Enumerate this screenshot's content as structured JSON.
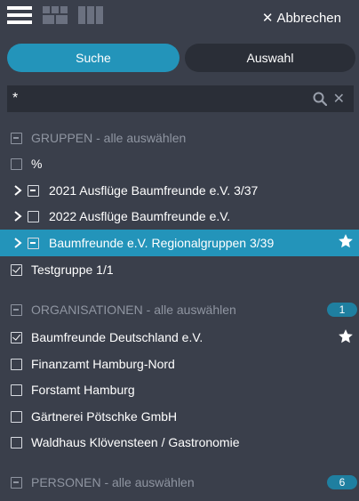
{
  "toolbar": {
    "cancel_label": "Abbrechen"
  },
  "tabs": [
    {
      "label": "Suche",
      "active": true
    },
    {
      "label": "Auswahl",
      "active": false
    }
  ],
  "search": {
    "value": "*"
  },
  "sections": {
    "groups": {
      "header": "GRUPPEN - alle auswählen",
      "items": [
        {
          "label": "%"
        },
        {
          "label": "2021 Ausflüge Baumfreunde e.V. 3/37"
        },
        {
          "label": "2022 Ausflüge Baumfreunde e.V."
        },
        {
          "label": "Baumfreunde e.V. Regionalgruppen 3/39"
        },
        {
          "label": "Testgruppe 1/1"
        }
      ]
    },
    "organisations": {
      "header": "ORGANISATIONEN - alle auswählen",
      "count": "1",
      "items": [
        {
          "label": "Baumfreunde Deutschland e.V."
        },
        {
          "label": "Finanzamt Hamburg-Nord"
        },
        {
          "label": "Forstamt Hamburg"
        },
        {
          "label": "Gärtnerei Pötschke GmbH"
        },
        {
          "label": "Waldhaus Klövensteen / Gastronomie"
        }
      ]
    },
    "persons": {
      "header": "PERSONEN - alle auswählen",
      "count": "6"
    }
  },
  "colors": {
    "background": "#3a3f4b",
    "accent": "#2394ba",
    "field": "#2a2e37",
    "muted_text": "#8f95a1"
  }
}
